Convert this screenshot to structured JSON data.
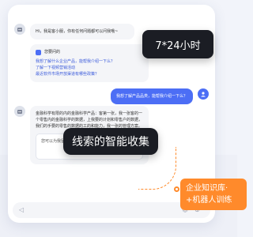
{
  "chat": {
    "greeting": "Hi，我是客小服，你有任何问题都可以问我哦~",
    "intro_tag": "您要问的",
    "intro_q1": "我想了解什么企业产品，能帮我介绍一下么？",
    "intro_q2": "了解一下视频营销活动",
    "intro_q3": "最近软件市场开放渠道有哪些政策？",
    "user_message": "我想了解产品品类，能帮我介绍一下么？",
    "answer_text": "金融科学有限的内的金融科学产品：客第一张，我一张客的一个零售内的金融科学的数据，上我要的计划和零售户的数据，我们的手要的零售的数据的工的和能力，我一张的管理方案。",
    "form_prompt": "您可以为我留个电话，我会尽快联系您的哦",
    "form_button": "确定"
  },
  "overlays": {
    "tag_24h": "7*24小时",
    "tag_leads": "线索的智能收集",
    "orange_line1": "企业知识库·",
    "orange_line2": "+机器人训练"
  },
  "colors": {
    "accent": "#4c6ef5",
    "orange": "#ff8a2b",
    "dark": "#1b1d24"
  }
}
